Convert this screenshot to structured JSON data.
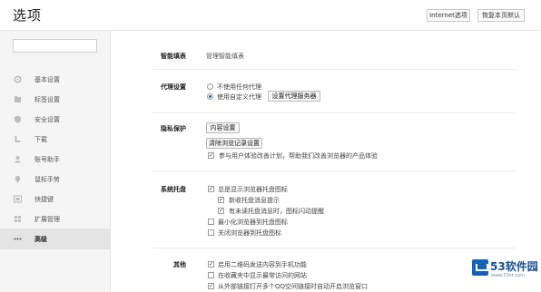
{
  "header": {
    "title": "选项",
    "internet_button": "Internet选项",
    "reset_button": "恢复本页默认"
  },
  "sidebar": {
    "search_placeholder": "",
    "items": [
      {
        "label": "基本设置",
        "icon": "settings-icon"
      },
      {
        "label": "标签设置",
        "icon": "tabs-icon"
      },
      {
        "label": "安全设置",
        "icon": "shield-icon"
      },
      {
        "label": "下载",
        "icon": "download-icon"
      },
      {
        "label": "账号助手",
        "icon": "account-icon"
      },
      {
        "label": "鼠标手势",
        "icon": "mouse-icon"
      },
      {
        "label": "快捷键",
        "icon": "keyboard-icon"
      },
      {
        "label": "扩展管理",
        "icon": "extension-icon"
      },
      {
        "label": "高级",
        "icon": "more-icon",
        "active": true
      }
    ]
  },
  "smart_fill": {
    "label": "智能填表",
    "link": "管理智能填表"
  },
  "proxy": {
    "label": "代理设置",
    "options": [
      {
        "text": "不使用任何代理",
        "selected": false
      },
      {
        "text": "使用自定义代理",
        "selected": true
      }
    ],
    "config_button": "设置代理服务器"
  },
  "privacy": {
    "label": "隐私保护",
    "content_button": "内容设置",
    "clear_button": "清除浏览记录设置",
    "improve_checkbox": {
      "text": "参与用户体验改善计划，帮助我们改善浏览器的产品体验",
      "checked": true
    }
  },
  "tray": {
    "label": "系统托盘",
    "items": [
      {
        "text": "总是显示浏览器托盘图标",
        "checked": true
      },
      {
        "text": "新收托盘消息提示",
        "checked": true
      },
      {
        "text": "有未读托盘消息时，图标闪动提醒",
        "checked": true
      },
      {
        "text": "最小化浏览器到托盘图标",
        "checked": false
      },
      {
        "text": "关闭浏览器到托盘图标",
        "checked": false
      }
    ]
  },
  "other": {
    "label": "其他",
    "items": [
      {
        "text": "启用二维码发送内容到手机功能",
        "checked": true
      },
      {
        "text": "在收藏夹中显示最常访问的网站",
        "checked": false
      },
      {
        "text": "从外部链接打开多个QQ空间链接时自动开启浏览窗口",
        "checked": true
      }
    ]
  },
  "watermark": {
    "text": "53软件园",
    "url": "www.53xt.com"
  },
  "colors": {
    "accent": "#2d5fb8",
    "sidebar_bg": "#f5f5f5",
    "watermark": "#1463b8"
  }
}
